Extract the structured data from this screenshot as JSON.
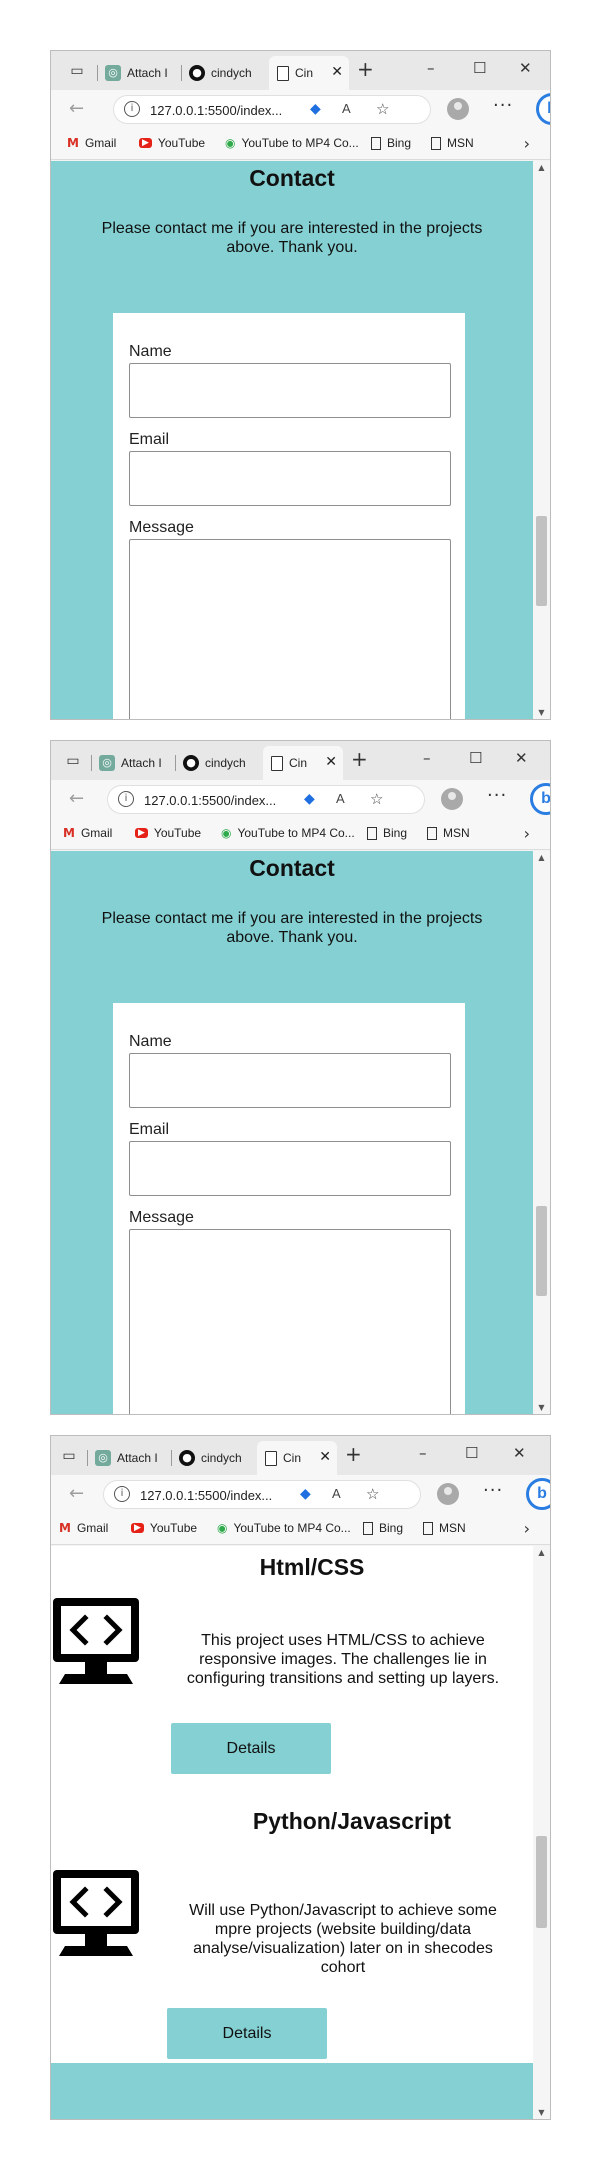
{
  "browser": {
    "tabs": [
      {
        "label": "Attach I"
      },
      {
        "label": "cindych"
      },
      {
        "label": "Cin"
      }
    ],
    "url": "127.0.0.1:5500/index...",
    "read_aloud_label": "A",
    "bing_label": "b",
    "favorites": [
      {
        "label": "Gmail",
        "icon": "gmail-icon"
      },
      {
        "label": "YouTube",
        "icon": "youtube-icon"
      },
      {
        "label": "YouTube to MP4 Co...",
        "icon": "converter-icon"
      },
      {
        "label": "Bing",
        "icon": "page-icon"
      },
      {
        "label": "MSN",
        "icon": "page-icon"
      }
    ]
  },
  "contact": {
    "title": "Contact",
    "intro": "Please contact me if you are interested in the projects above. Thank you.",
    "name_label": "Name",
    "email_label": "Email",
    "message_label": "Message"
  },
  "projects": [
    {
      "title": "Html/CSS",
      "description": "This project uses HTML/CSS to achieve responsive images. The challenges lie in configuring transitions and setting up layers.",
      "button": "Details"
    },
    {
      "title": "Python/Javascript",
      "description": "Will use Python/Javascript to achieve some mpre projects (website building/data analyse/visualization) later on in shecodes cohort",
      "button": "Details"
    }
  ],
  "colors": {
    "accent": "#84d0d2",
    "edge_blue": "#2a7de1"
  }
}
